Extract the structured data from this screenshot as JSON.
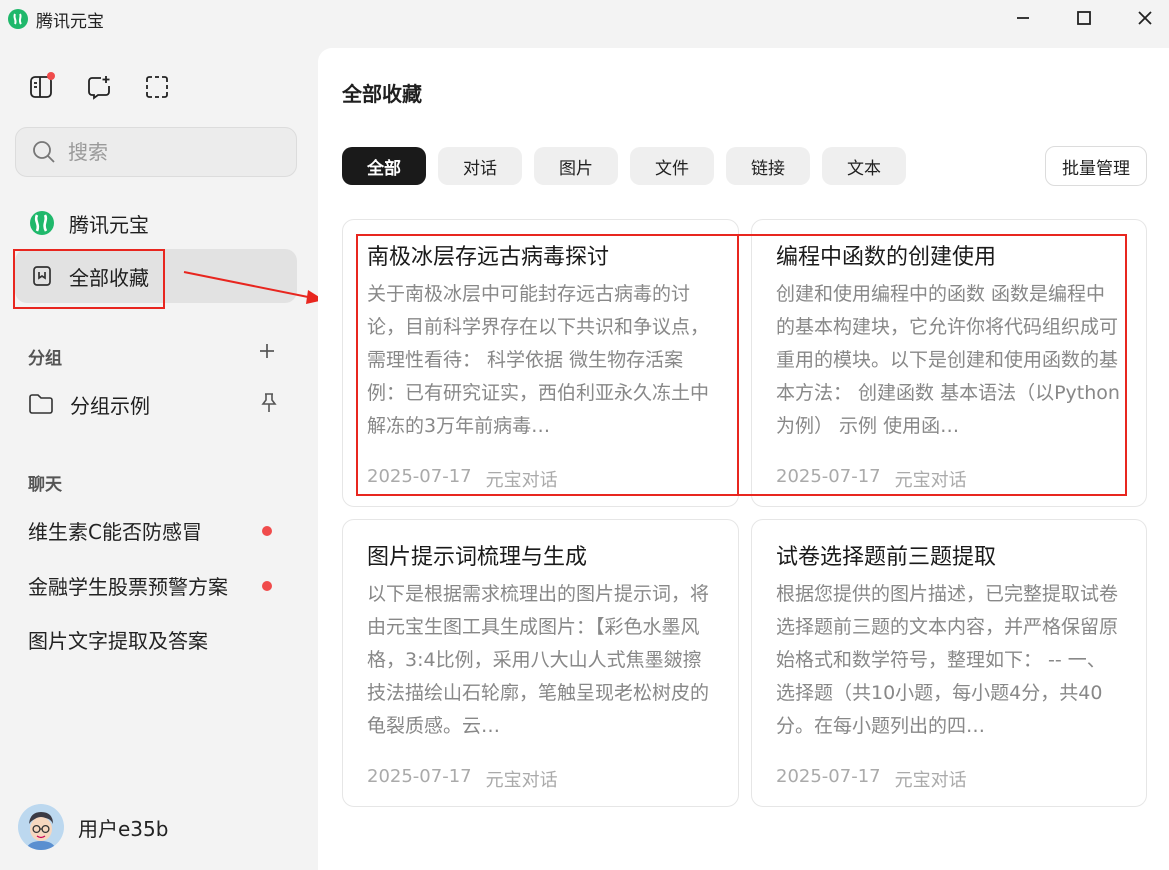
{
  "window": {
    "title": "腾讯元宝",
    "accent": "#1fb86b"
  },
  "sidebar": {
    "search_placeholder": "搜索",
    "nav": [
      {
        "label": "腾讯元宝",
        "icon": "yuanbao-logo-icon"
      },
      {
        "label": "全部收藏",
        "icon": "bookmark-icon"
      }
    ],
    "group_section": "分组",
    "group_items": [
      {
        "label": "分组示例"
      }
    ],
    "chat_section": "聊天",
    "chats": [
      {
        "label": "维生素C能否防感冒",
        "unread": true
      },
      {
        "label": "金融学生股票预警方案",
        "unread": true
      },
      {
        "label": "图片文字提取及答案",
        "unread": false
      }
    ],
    "user": {
      "name": "用户e35b"
    }
  },
  "main": {
    "title": "全部收藏",
    "filters": [
      "全部",
      "对话",
      "图片",
      "文件",
      "链接",
      "文本"
    ],
    "active_filter": "全部",
    "batch_label": "批量管理",
    "cards": [
      {
        "title": "南极冰层存远古病毒探讨",
        "body": "关于南极冰层中可能封存远古病毒的讨论，目前科学界存在以下共识和争议点，需理性看待： 科学依据 微生物存活案例：已有研究证实，西伯利亚永久冻土中解冻的3万年前病毒…",
        "date": "2025-07-17",
        "source": "元宝对话"
      },
      {
        "title": "编程中函数的创建使用",
        "body": "创建和使用编程中的函数 函数是编程中的基本构建块，它允许你将代码组织成可重用的模块。以下是创建和使用函数的基本方法： 创建函数 基本语法（以Python为例） 示例 使用函…",
        "date": "2025-07-17",
        "source": "元宝对话"
      },
      {
        "title": "图片提示词梳理与生成",
        "body": "以下是根据需求梳理出的图片提示词，将由元宝生图工具生成图片：【彩色水墨风格，3:4比例，采用八大山人式焦墨皴擦技法描绘山石轮廓，笔触呈现老松树皮的龟裂质感。云…",
        "date": "2025-07-17",
        "source": "元宝对话"
      },
      {
        "title": "试卷选择题前三题提取",
        "body": "根据您提供的图片描述，已完整提取试卷选择题前三题的文本内容，并严格保留原始格式和数学符号，整理如下： -- 一、选择题（共10小题，每小题4分，共40分。在每小题列出的四…",
        "date": "2025-07-17",
        "source": "元宝对话"
      }
    ]
  }
}
